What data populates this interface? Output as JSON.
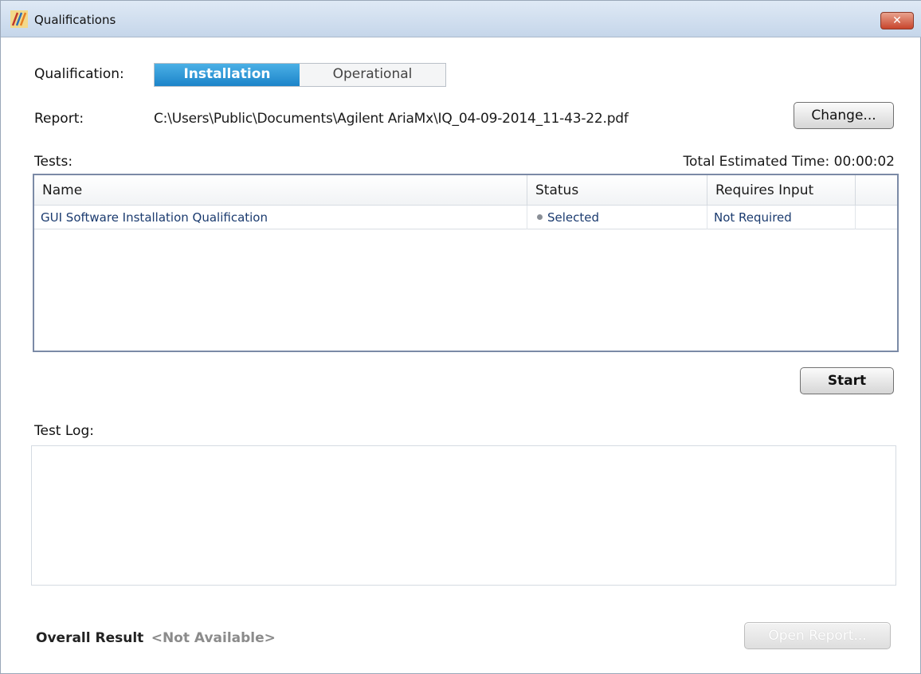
{
  "window": {
    "title": "Qualifications",
    "close_label": "✕"
  },
  "qualification": {
    "label": "Qualification:",
    "options": [
      "Installation",
      "Operational"
    ],
    "selected": "Installation"
  },
  "report": {
    "label": "Report:",
    "path": "C:\\Users\\Public\\Documents\\Agilent AriaMx\\IQ_04-09-2014_11-43-22.pdf",
    "change_label": "Change..."
  },
  "tests": {
    "label": "Tests:",
    "estimated_time": "Total Estimated Time: 00:00:02",
    "columns": [
      "Name",
      "Status",
      "Requires Input"
    ],
    "rows": [
      {
        "name": "GUI Software Installation Qualification",
        "status": "Selected",
        "requires_input": "Not Required"
      }
    ]
  },
  "start_label": "Start",
  "test_log": {
    "label": "Test Log:"
  },
  "overall": {
    "label": "Overall Result",
    "value": "<Not Available>"
  },
  "open_report_label": "Open Report...",
  "colors": {
    "accent": "#1c84c9",
    "row_text": "#1b3b6f",
    "close": "#c8452c"
  }
}
